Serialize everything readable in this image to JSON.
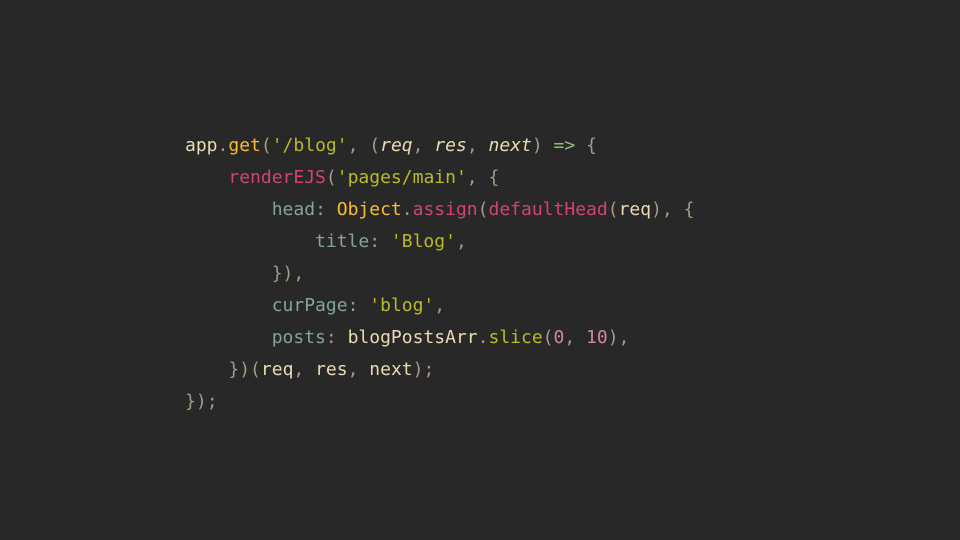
{
  "code": {
    "t_app": "app",
    "t_get": "get",
    "t_route": "'/blog'",
    "t_req": "req",
    "t_res": "res",
    "t_next": "next",
    "t_renderEJS": "renderEJS",
    "t_pagesmain": "'pages/main'",
    "t_head": "head",
    "t_Object": "Object",
    "t_assign": "assign",
    "t_defaultHead": "defaultHead",
    "t_title": "title",
    "t_blogstr": "'Blog'",
    "t_curPage": "curPage",
    "t_blogval": "'blog'",
    "t_posts": "posts",
    "t_blogPostsArr": "blogPostsArr",
    "t_slice": "slice",
    "t_zero": "0",
    "t_ten": "10"
  }
}
